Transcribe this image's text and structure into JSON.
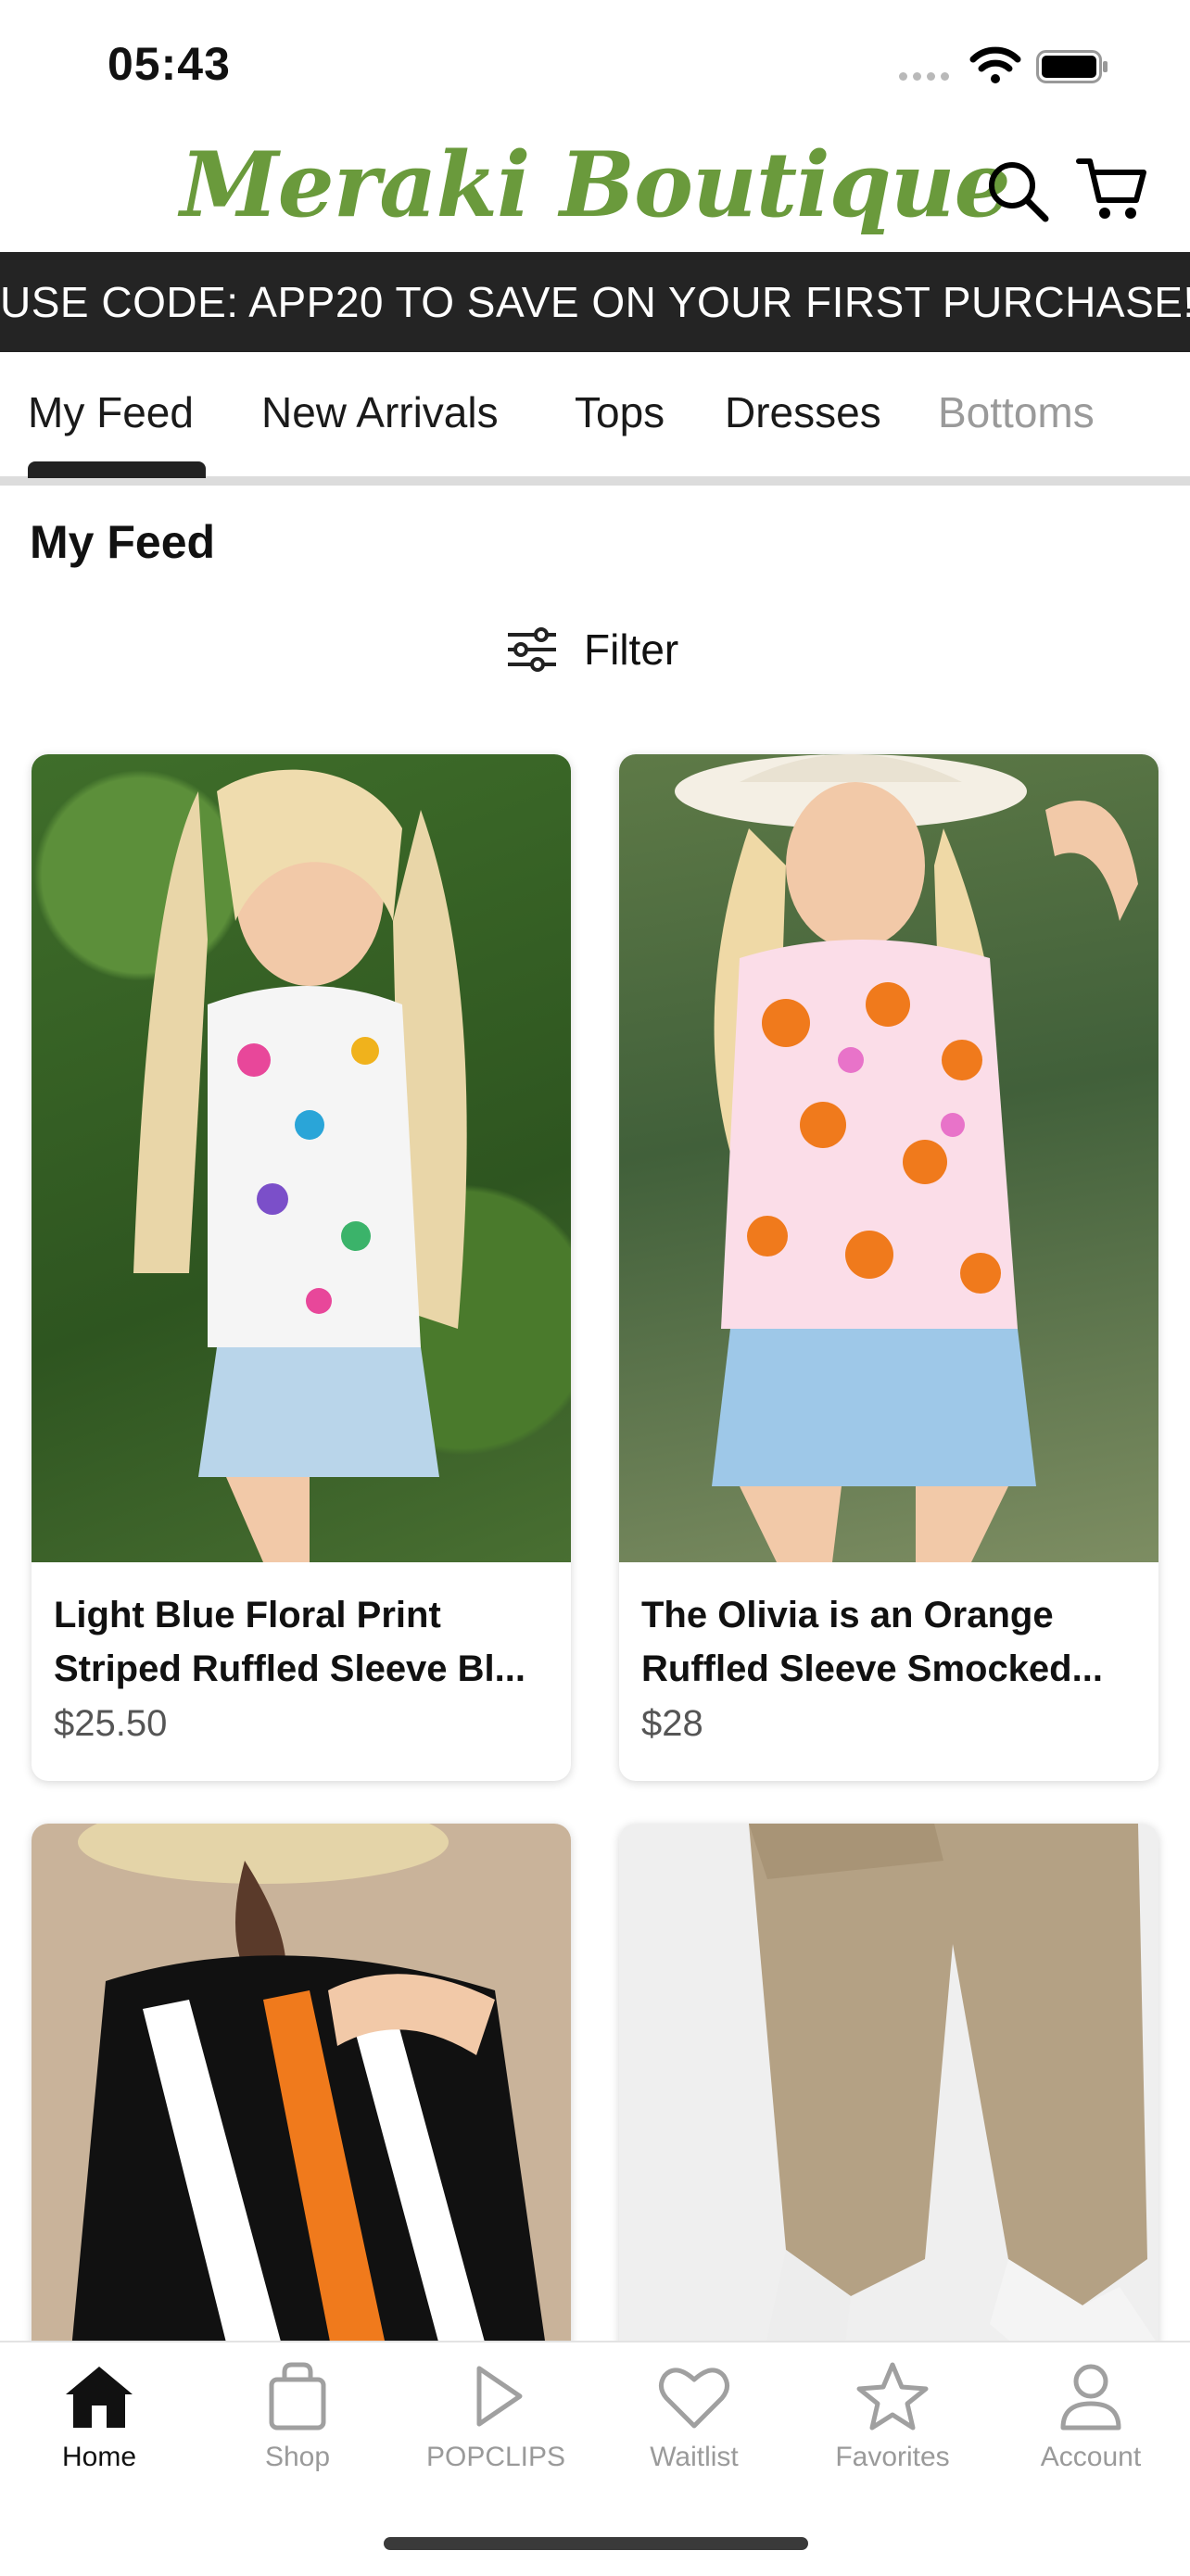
{
  "status_bar": {
    "time": "05:43"
  },
  "header": {
    "logo_text": "Meraki Boutique",
    "search_icon": "search-icon",
    "cart_icon": "cart-icon"
  },
  "promo_banner": {
    "text": "USE CODE: APP20 TO SAVE ON YOUR FIRST PURCHASE!"
  },
  "tabs": [
    {
      "label": "My Feed",
      "selected": true
    },
    {
      "label": "New Arrivals",
      "selected": false
    },
    {
      "label": "Tops",
      "selected": false
    },
    {
      "label": "Dresses",
      "selected": false
    },
    {
      "label": "Bottoms",
      "selected": false
    }
  ],
  "feed": {
    "title": "My Feed",
    "filter_label": "Filter",
    "products": [
      {
        "title_line1": "Light Blue Floral Print",
        "title_line2": "Striped Ruffled Sleeve Bl...",
        "price": "$25.50"
      },
      {
        "title_line1": "The Olivia is an Orange",
        "title_line2": "Ruffled Sleeve Smocked...",
        "price": "$28"
      },
      {
        "title_line1": "",
        "title_line2": "",
        "price": ""
      },
      {
        "title_line1": "",
        "title_line2": "",
        "price": ""
      }
    ]
  },
  "bottom_nav": [
    {
      "label": "Home",
      "icon": "home-icon",
      "active": true
    },
    {
      "label": "Shop",
      "icon": "bag-icon",
      "active": false
    },
    {
      "label": "POPCLIPS",
      "icon": "play-icon",
      "active": false
    },
    {
      "label": "Waitlist",
      "icon": "heart-icon",
      "active": false
    },
    {
      "label": "Favorites",
      "icon": "star-icon",
      "active": false
    },
    {
      "label": "Account",
      "icon": "person-icon",
      "active": false
    }
  ],
  "colors": {
    "brand_green": "#6a9a3c",
    "banner_bg": "#242424",
    "accent_orange": "#f07a1c"
  }
}
